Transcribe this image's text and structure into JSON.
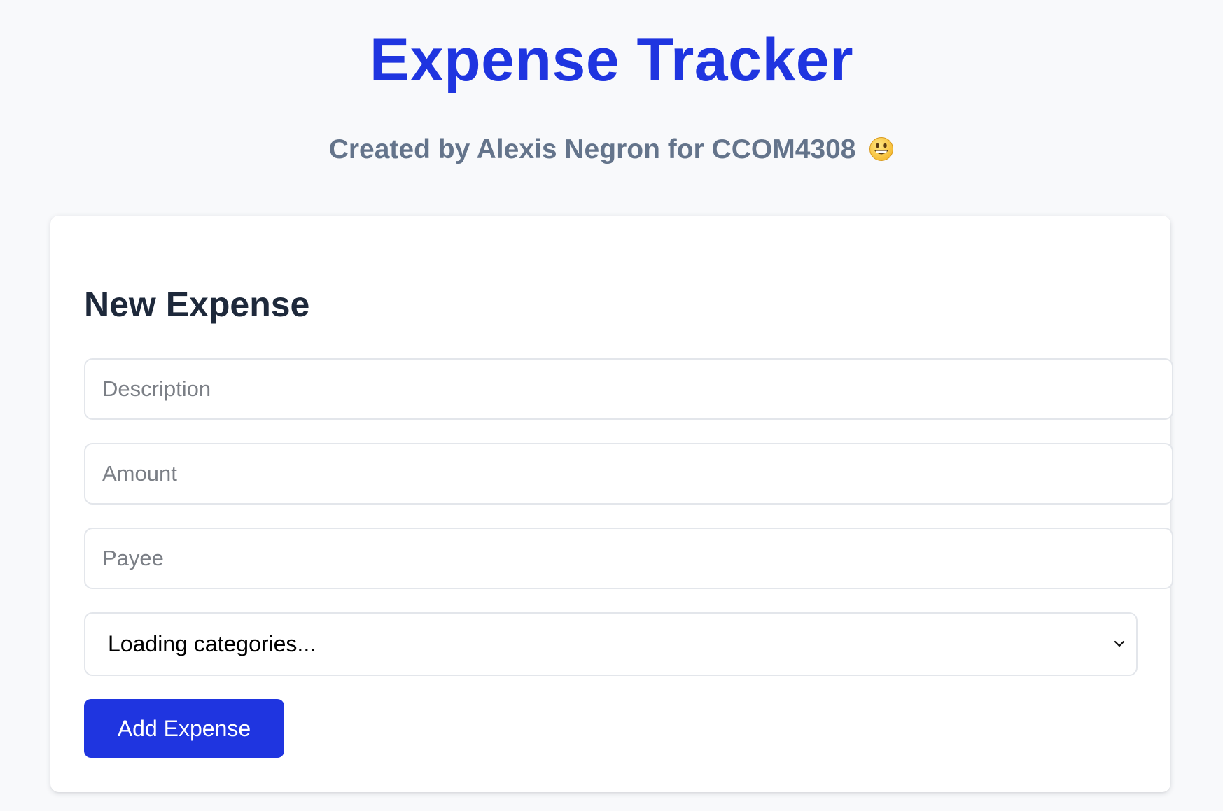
{
  "header": {
    "title": "Expense Tracker",
    "subtitle": "Created by Alexis Negron for CCOM4308",
    "subtitle_emoji_icon": "grinning-face-icon"
  },
  "form": {
    "title": "New Expense",
    "description_placeholder": "Description",
    "amount_placeholder": "Amount",
    "payee_placeholder": "Payee",
    "category_selected": "Loading categories...",
    "category_select_icon": "chevron-down-icon",
    "submit_label": "Add Expense"
  },
  "colors": {
    "accent": "#1f35e0",
    "subtitle": "#64748b",
    "heading": "#1e293b",
    "background": "#f8f9fb",
    "card": "#ffffff",
    "border": "#e3e6eb"
  }
}
